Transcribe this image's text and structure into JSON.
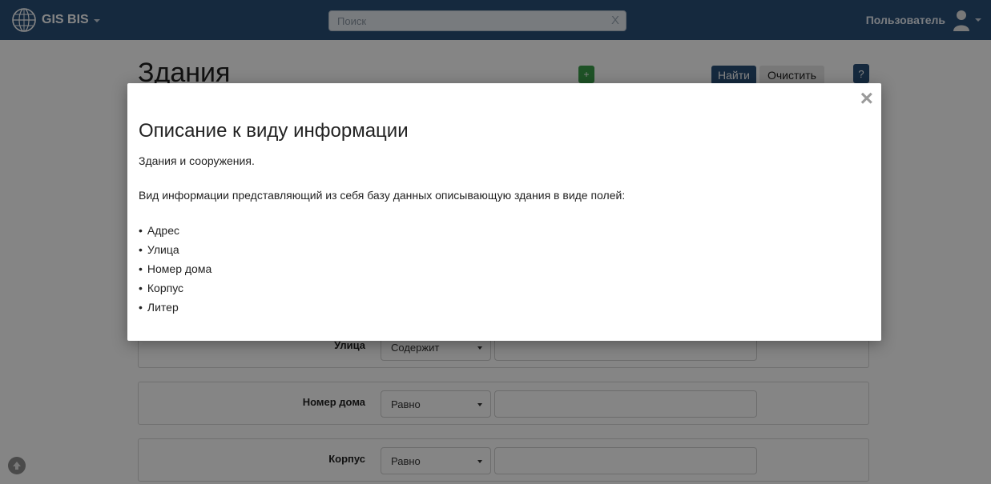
{
  "navbar": {
    "brand": "GIS BIS",
    "search_placeholder": "Поиск",
    "search_clear": "X",
    "user_name": "Пользователь"
  },
  "page": {
    "title": "Здания",
    "add_label": "+",
    "find_label": "Найти",
    "clear_label": "Очистить",
    "help_label": "?"
  },
  "filters": [
    {
      "label": "Улица",
      "operator": "Содержит",
      "value": ""
    },
    {
      "label": "Номер дома",
      "operator": "Равно",
      "value": ""
    },
    {
      "label": "Корпус",
      "operator": "Равно",
      "value": ""
    }
  ],
  "modal": {
    "close_label": "×",
    "title": "Описание к виду информации",
    "paragraph1": "Здания и сооружения.",
    "paragraph2": "Вид информации представляющий из себя базу данных описывающую здания в виде полей:",
    "fields": [
      "Адрес",
      "Улица",
      "Номер дома",
      "Корпус",
      "Литер"
    ]
  },
  "colors": {
    "navbar": "#2a4f77",
    "add_button": "#3a9d4a",
    "primary_button": "#2a4f77"
  }
}
